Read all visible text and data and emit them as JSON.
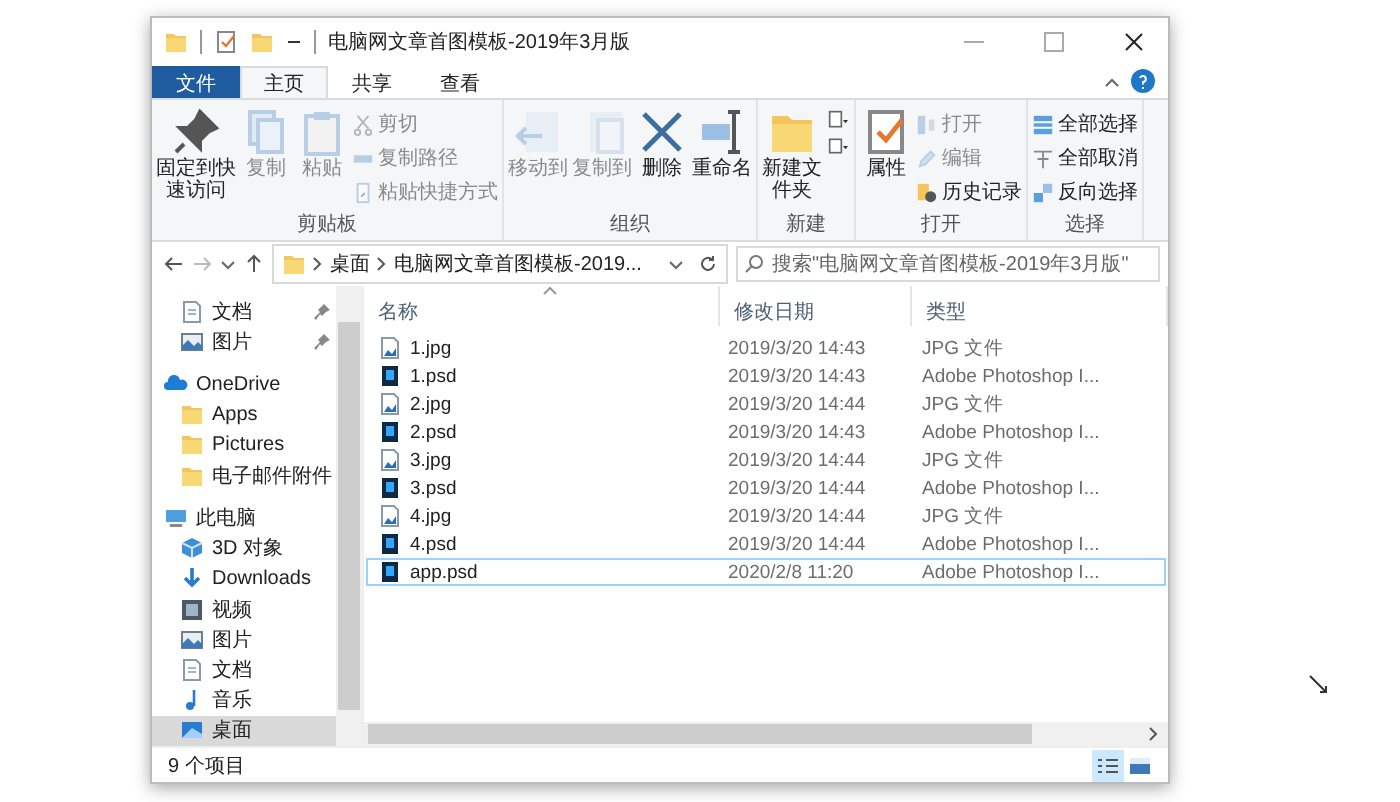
{
  "window": {
    "title": "电脑网文章首图模板-2019年3月版"
  },
  "tabs": [
    {
      "label": "文件",
      "kind": "file",
      "selected": false
    },
    {
      "label": "主页",
      "kind": "tab",
      "selected": true
    },
    {
      "label": "共享",
      "kind": "tab",
      "selected": false
    },
    {
      "label": "查看",
      "kind": "tab",
      "selected": false
    }
  ],
  "ribbon": [
    {
      "label": "剪贴板",
      "items": [
        {
          "kind": "large",
          "label": "固定到快速访问",
          "disabled": false
        },
        {
          "kind": "large",
          "label": "复制",
          "disabled": true
        },
        {
          "kind": "large",
          "label": "粘贴",
          "disabled": true
        },
        {
          "kind": "small",
          "entries": [
            {
              "label": "剪切",
              "disabled": true
            },
            {
              "label": "复制路径",
              "disabled": true
            },
            {
              "label": "粘贴快捷方式",
              "disabled": true
            }
          ]
        }
      ]
    },
    {
      "label": "组织",
      "items": [
        {
          "kind": "large",
          "label": "移动到",
          "disabled": true
        },
        {
          "kind": "large",
          "label": "复制到",
          "disabled": true
        },
        {
          "kind": "large",
          "label": "删除",
          "disabled": false
        },
        {
          "kind": "large",
          "label": "重命名",
          "disabled": false
        }
      ]
    },
    {
      "label": "新建",
      "items": [
        {
          "kind": "large",
          "label": "新建文件夹",
          "disabled": false
        },
        {
          "kind": "tiny",
          "entries": [
            {
              "disabled": false
            },
            {
              "disabled": false
            }
          ]
        }
      ]
    },
    {
      "label": "打开",
      "items": [
        {
          "kind": "large",
          "label": "属性",
          "disabled": false
        },
        {
          "kind": "small",
          "entries": [
            {
              "label": "打开",
              "disabled": true
            },
            {
              "label": "编辑",
              "disabled": true
            },
            {
              "label": "历史记录",
              "disabled": false
            }
          ]
        }
      ]
    },
    {
      "label": "选择",
      "items": [
        {
          "kind": "small",
          "entries": [
            {
              "label": "全部选择",
              "disabled": false
            },
            {
              "label": "全部取消",
              "disabled": false
            },
            {
              "label": "反向选择",
              "disabled": false
            }
          ]
        }
      ]
    }
  ],
  "address": {
    "crumbs": [
      "桌面",
      "电脑网文章首图模板-2019..."
    ],
    "search_placeholder": "搜索\"电脑网文章首图模板-2019年3月版\""
  },
  "sidebar": {
    "items": [
      {
        "label": "文档",
        "pinned": true,
        "selected": false
      },
      {
        "label": "图片",
        "pinned": true,
        "selected": false
      }
    ],
    "tree": [
      {
        "label": "OneDrive",
        "selected": false,
        "children": [
          {
            "label": "Apps",
            "selected": false
          },
          {
            "label": "Pictures",
            "selected": false
          },
          {
            "label": "电子邮件附件",
            "selected": false
          }
        ]
      },
      {
        "label": "此电脑",
        "selected": false,
        "children": [
          {
            "label": "3D 对象",
            "selected": false
          },
          {
            "label": "Downloads",
            "selected": false
          },
          {
            "label": "视频",
            "selected": false
          },
          {
            "label": "图片",
            "selected": false
          },
          {
            "label": "文档",
            "selected": false
          },
          {
            "label": "音乐",
            "selected": false
          },
          {
            "label": "桌面",
            "selected": true
          }
        ]
      }
    ]
  },
  "table": {
    "columns": [
      {
        "label": "名称",
        "sorted": true
      },
      {
        "label": "修改日期",
        "sorted": false
      },
      {
        "label": "类型",
        "sorted": false
      }
    ],
    "rows": [
      {
        "name": "1.jpg",
        "kind": "jpg",
        "modified": "2019/3/20 14:43",
        "type": "JPG 文件",
        "focused": false
      },
      {
        "name": "1.psd",
        "kind": "psd",
        "modified": "2019/3/20 14:43",
        "type": "Adobe Photoshop I...",
        "focused": false
      },
      {
        "name": "2.jpg",
        "kind": "jpg",
        "modified": "2019/3/20 14:44",
        "type": "JPG 文件",
        "focused": false
      },
      {
        "name": "2.psd",
        "kind": "psd",
        "modified": "2019/3/20 14:43",
        "type": "Adobe Photoshop I...",
        "focused": false
      },
      {
        "name": "3.jpg",
        "kind": "jpg",
        "modified": "2019/3/20 14:44",
        "type": "JPG 文件",
        "focused": false
      },
      {
        "name": "3.psd",
        "kind": "psd",
        "modified": "2019/3/20 14:44",
        "type": "Adobe Photoshop I...",
        "focused": false
      },
      {
        "name": "4.jpg",
        "kind": "jpg",
        "modified": "2019/3/20 14:44",
        "type": "JPG 文件",
        "focused": false
      },
      {
        "name": "4.psd",
        "kind": "psd",
        "modified": "2019/3/20 14:44",
        "type": "Adobe Photoshop I...",
        "focused": false
      },
      {
        "name": "app.psd",
        "kind": "psd",
        "modified": "2020/2/8 11:20",
        "type": "Adobe Photoshop I...",
        "focused": true
      }
    ]
  },
  "status_bar": {
    "count": "9 个项目",
    "views": [
      {
        "kind": "details",
        "selected": true
      },
      {
        "kind": "thumbnails",
        "selected": false
      }
    ]
  }
}
